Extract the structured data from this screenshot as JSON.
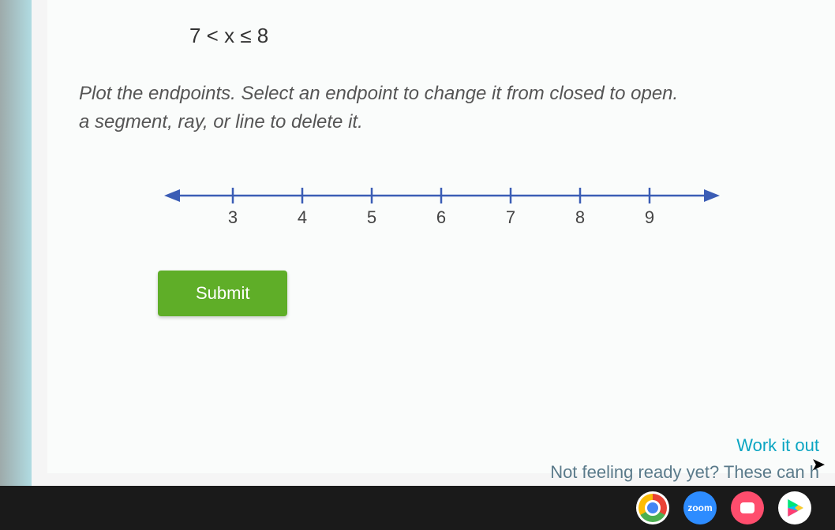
{
  "problem": {
    "inequality": "7 < x ≤ 8",
    "instruction_line1": "Plot the endpoints. Select an endpoint to change it from closed to open.",
    "instruction_line2": "a segment, ray, or line to delete it."
  },
  "numberline": {
    "ticks": [
      "3",
      "4",
      "5",
      "6",
      "7",
      "8",
      "9"
    ]
  },
  "buttons": {
    "submit": "Submit"
  },
  "hints": {
    "work_it_out": "Work it out",
    "not_ready": "Not feeling ready yet? These can h"
  },
  "taskbar": {
    "zoom_label": "zoom"
  },
  "chart_data": {
    "type": "numberline",
    "min_tick": 3,
    "max_tick": 9,
    "step": 1,
    "inequality": {
      "lower": 7,
      "lower_open": true,
      "upper": 8,
      "upper_open": false
    },
    "arrows": "both",
    "ticks": [
      3,
      4,
      5,
      6,
      7,
      8,
      9
    ]
  }
}
